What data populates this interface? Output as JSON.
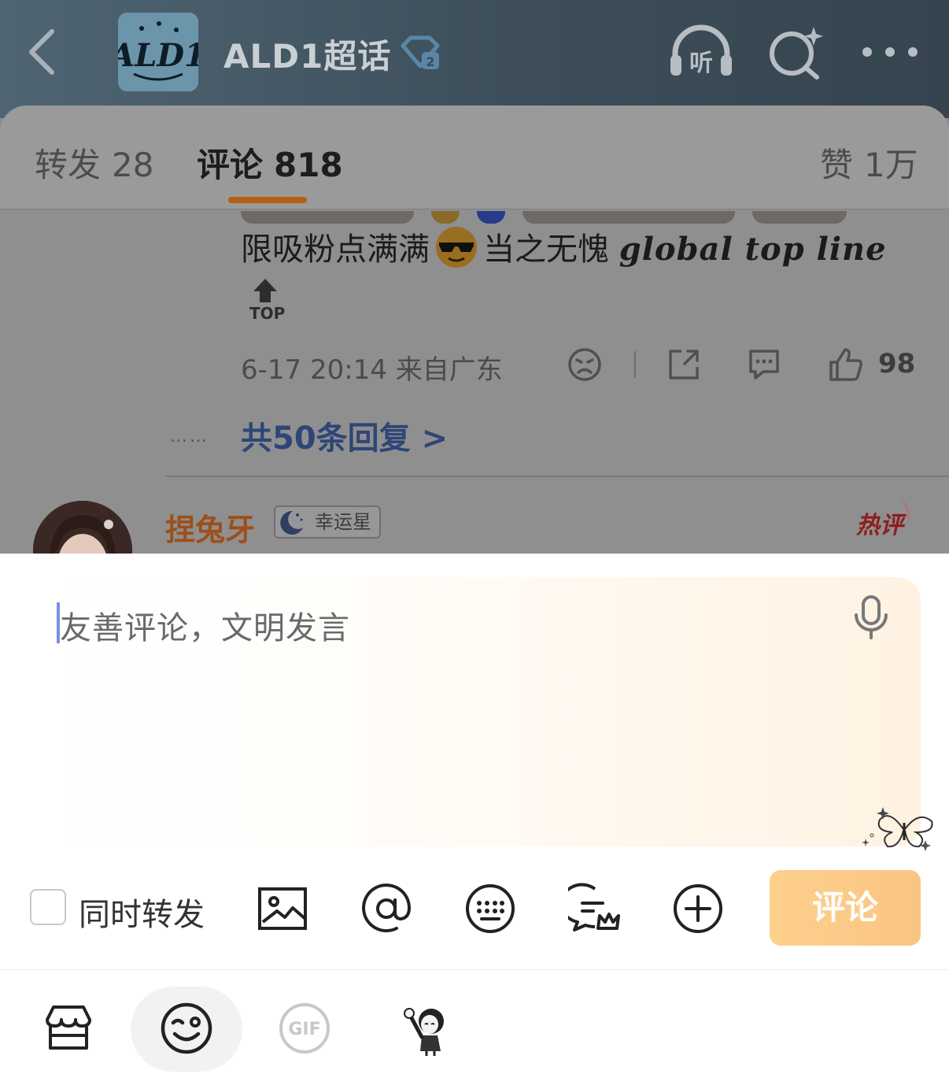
{
  "header": {
    "topic_title": "ALD1超话",
    "topic_avatar_text": "ALD1",
    "topic_badge_level": "2",
    "listen_label": "听"
  },
  "tabs": [
    {
      "label": "转发",
      "count": "28"
    },
    {
      "label": "评论",
      "count": "818"
    },
    {
      "label": "赞",
      "count": "1万"
    }
  ],
  "comment": {
    "text_before": "限吸粉点满满",
    "text_middle": "当之无愧",
    "text_fancy": "global top line",
    "top_label": "TOP",
    "meta": "6-17 20:14 来自广东",
    "like_count": "98",
    "reply_link": "共50条回复 >",
    "reply_dots": "……"
  },
  "next_comment": {
    "username": "捏兔牙",
    "tag": "幸运星",
    "hot_label": "热评"
  },
  "compose": {
    "placeholder": "友善评论，文明发言",
    "repost_label": "同时转发",
    "repost_checked": false,
    "submit_label": "评论",
    "gif_label": "GIF"
  },
  "colors": {
    "accent_orange": "#fbc483",
    "tab_underline": "#f07a18",
    "link_blue": "#2e4677"
  }
}
